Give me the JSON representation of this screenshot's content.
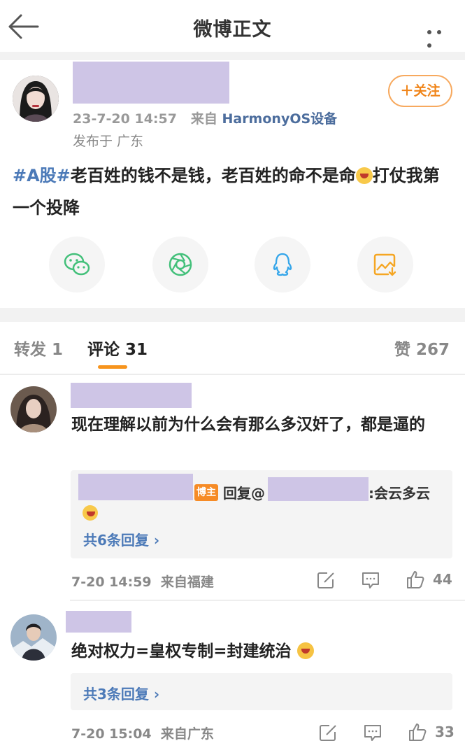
{
  "header": {
    "title": "微博正文"
  },
  "post": {
    "timestamp": "23-7-20 14:57",
    "from_prefix": "来自",
    "source": "HarmonyOS设备",
    "location": "发布于 广东",
    "follow_label": "＋关注",
    "hashtag": "#A股#",
    "text_part1": "老百姓的钱不是钱，老百姓的命不是命",
    "text_part2": "打仗我第一个投降"
  },
  "share_icons": [
    "wechat-icon",
    "moments-icon",
    "qq-icon",
    "save-image-icon"
  ],
  "tabs": {
    "repost": "转发 1",
    "comments": "评论 31",
    "likes": "赞 267"
  },
  "comments": [
    {
      "text": "现在理解以前为什么会有那么多汉奸了，都是逼的",
      "reply": {
        "badge": "博主",
        "prefix": "回复@",
        "suffix": ":会云多云",
        "more": "共6条回复 ›"
      },
      "time": "7-20 14:59",
      "from": "来自福建",
      "likes": "44"
    },
    {
      "text": "绝对权力=皇权专制=封建统治",
      "reply": {
        "more": "共3条回复 ›"
      },
      "time": "7-20 15:04",
      "from": "来自广东",
      "likes": "33"
    }
  ],
  "colors": {
    "accent": "#f7941d",
    "link": "#4c7ab8",
    "redaction": "#cec5e6"
  }
}
